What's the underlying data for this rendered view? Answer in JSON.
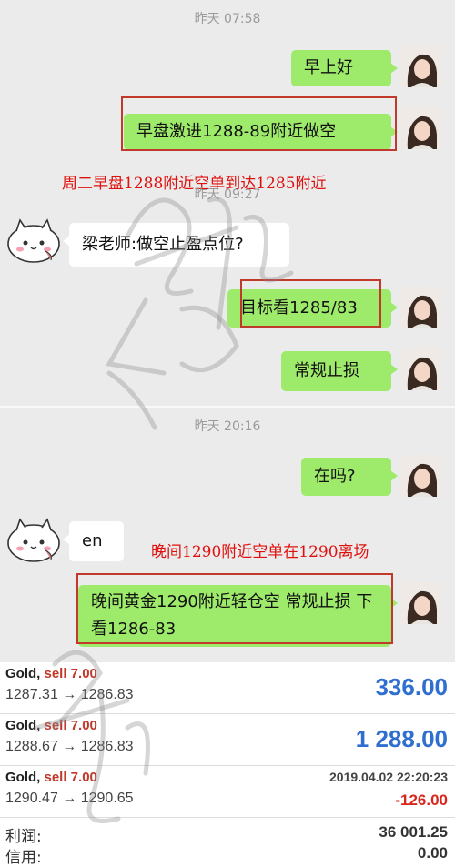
{
  "chat": {
    "timestamps": [
      "昨天 07:58",
      "昨天 09:27",
      "昨天 20:16"
    ],
    "messages": [
      {
        "from": "me",
        "text": "早上好"
      },
      {
        "from": "me",
        "text": "早盘激进1288-89附近做空"
      },
      {
        "from": "other",
        "text": "梁老师:做空止盈点位?"
      },
      {
        "from": "me",
        "text": "目标看1285/83"
      },
      {
        "from": "me",
        "text": "常规止损"
      },
      {
        "from": "me",
        "text": "在吗?"
      },
      {
        "from": "other",
        "text": "en"
      },
      {
        "from": "me",
        "text": "晚间黄金1290附近轻仓空  常规止损 下看1286-83"
      }
    ],
    "annotations": [
      "周二早盘1288附近空单到达1285附近",
      "晚间1290附近空单在1290离场"
    ]
  },
  "trades": [
    {
      "symbol": "Gold,",
      "side": "sell 7.00",
      "prices": "1287.31 → 1286.83",
      "profit": "336.00",
      "time": ""
    },
    {
      "symbol": "Gold,",
      "side": "sell 7.00",
      "prices": "1288.67 → 1286.83",
      "profit": "1 288.00",
      "time": ""
    },
    {
      "symbol": "Gold,",
      "side": "sell 7.00",
      "prices": "1290.47 → 1290.65",
      "profit": "-126.00",
      "time": "2019.04.02 22:20:23"
    }
  ],
  "summary": {
    "profit_label": "利润:",
    "profit_value": "36 001.25",
    "credit_label": "信用:",
    "credit_value": "0.00"
  },
  "colors": {
    "bubble_me": "#9eea6a",
    "positive": "#2f6fd0",
    "negative": "#d9261c",
    "annotation": "#e0100e"
  }
}
